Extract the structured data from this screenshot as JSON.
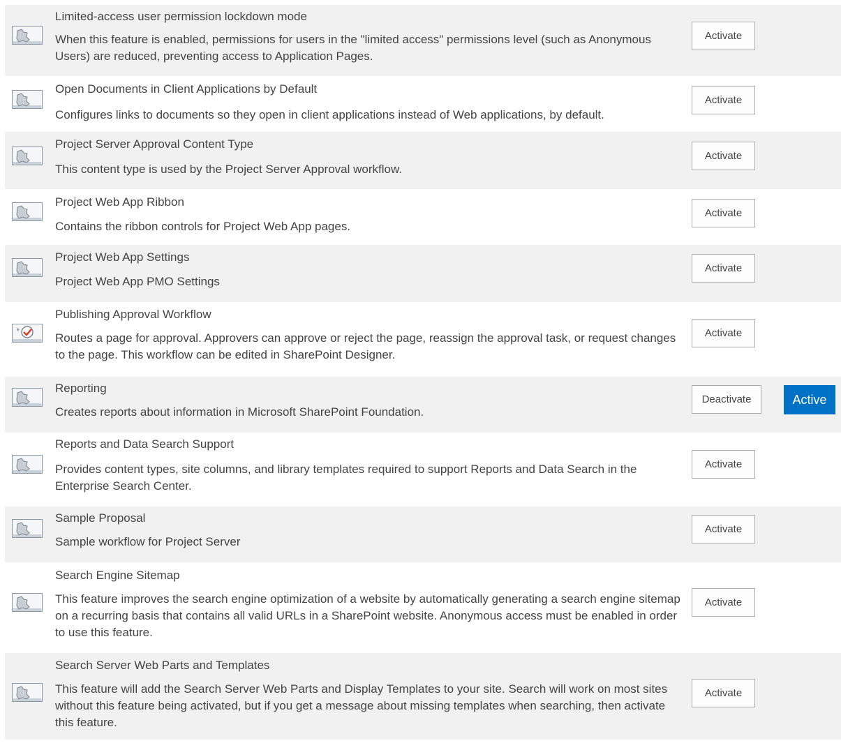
{
  "activate_label": "Activate",
  "deactivate_label": "Deactivate",
  "active_status_label": "Active",
  "active_badge_color": "#0072c6",
  "features": [
    {
      "title": "Limited-access user permission lockdown mode",
      "description": "When this feature is enabled, permissions for users in the \"limited access\" permissions level (such as Anonymous Users) are reduced, preventing access to Application Pages.",
      "icon": "feature-icon",
      "button": "Activate",
      "status": ""
    },
    {
      "title": "Open Documents in Client Applications by Default",
      "description": "Configures links to documents so they open in client applications instead of Web applications, by default.",
      "icon": "feature-icon",
      "button": "Activate",
      "status": ""
    },
    {
      "title": "Project Server Approval Content Type",
      "description": "This content type is used by the Project Server Approval workflow.",
      "icon": "feature-icon",
      "button": "Activate",
      "status": ""
    },
    {
      "title": "Project Web App Ribbon",
      "description": "Contains the ribbon controls for Project Web App pages.",
      "icon": "feature-icon",
      "button": "Activate",
      "status": ""
    },
    {
      "title": "Project Web App Settings",
      "description": "Project Web App PMO Settings",
      "icon": "feature-icon",
      "button": "Activate",
      "status": ""
    },
    {
      "title": "Publishing Approval Workflow",
      "description": "Routes a page for approval. Approvers can approve or reject the page, reassign the approval task, or request changes to the page. This workflow can be edited in SharePoint Designer.",
      "icon": "workflow-icon",
      "button": "Activate",
      "status": ""
    },
    {
      "title": "Reporting",
      "description": "Creates reports about information in Microsoft SharePoint Foundation.",
      "icon": "feature-icon",
      "button": "Deactivate",
      "status": "Active"
    },
    {
      "title": "Reports and Data Search Support",
      "description": "Provides content types, site columns, and library templates required to support Reports and Data Search in the Enterprise Search Center.",
      "icon": "feature-icon",
      "button": "Activate",
      "status": ""
    },
    {
      "title": "Sample Proposal",
      "description": "Sample workflow for Project Server",
      "icon": "feature-icon",
      "button": "Activate",
      "status": ""
    },
    {
      "title": "Search Engine Sitemap",
      "description": "This feature improves the search engine optimization of a website by automatically generating a search engine sitemap on a recurring basis that contains all valid URLs in a SharePoint website. Anonymous access must be enabled in order to use this feature.",
      "icon": "feature-icon",
      "button": "Activate",
      "status": ""
    },
    {
      "title": "Search Server Web Parts and Templates",
      "description": "This feature will add the Search Server Web Parts and Display Templates to your site. Search will work on most sites without this feature being activated, but if you get a message about missing templates when searching, then activate this feature.",
      "icon": "feature-icon",
      "button": "Activate",
      "status": ""
    }
  ]
}
